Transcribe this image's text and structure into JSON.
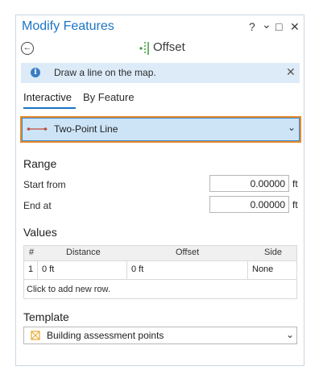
{
  "window": {
    "title": "Modify Features",
    "controls": {
      "help": "?",
      "menu": "⌄",
      "maximize": "□",
      "close": "✕"
    }
  },
  "tool": {
    "back_icon": "back-arrow-icon",
    "title": "Offset",
    "icon": "offset-tool-icon"
  },
  "banner": {
    "icon": "info-icon",
    "text": "Draw a line on the map.",
    "close": "✕"
  },
  "tabs": [
    {
      "label": "Interactive",
      "active": true
    },
    {
      "label": "By Feature",
      "active": false
    }
  ],
  "method": {
    "label": "Two-Point Line",
    "icon": "two-point-line-icon",
    "chevron": "⌄"
  },
  "range": {
    "heading": "Range",
    "start_label": "Start from",
    "start_value": "0.00000",
    "start_unit": "ft",
    "end_label": "End at",
    "end_value": "0.00000",
    "end_unit": "ft"
  },
  "values": {
    "heading": "Values",
    "columns": [
      "#",
      "Distance",
      "Offset",
      "Side"
    ],
    "rows": [
      {
        "num": "1",
        "distance": "0 ft",
        "offset": "0 ft",
        "side": "None"
      }
    ],
    "add_row": "Click to add new row."
  },
  "template": {
    "heading": "Template",
    "value": "Building assessment points",
    "icon": "point-template-icon",
    "chevron": "⌄"
  },
  "colors": {
    "accent": "#1b74c4",
    "selection_border": "#e6892a",
    "selection_fill": "#cde4f7",
    "banner_fill": "#dcebf7"
  }
}
